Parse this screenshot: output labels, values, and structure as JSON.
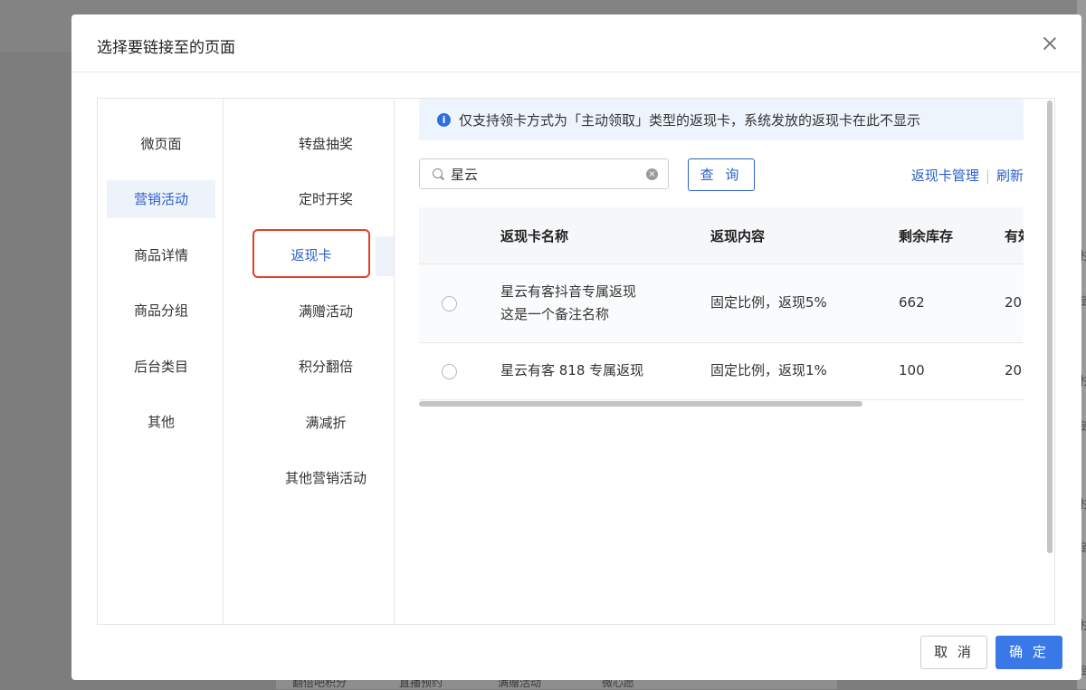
{
  "background": {
    "right_chars": [
      "杉",
      "链",
      "杉",
      "链",
      "杉",
      "链",
      "杉",
      "链"
    ],
    "bottom_labels": [
      "翻倍吧积分",
      "直播预约",
      "满赠活动",
      "微心愿"
    ]
  },
  "modal": {
    "title": "选择要链接至的页面",
    "close_icon": "close-icon"
  },
  "categories": [
    {
      "label": "微页面"
    },
    {
      "label": "营销活动"
    },
    {
      "label": "商品详情"
    },
    {
      "label": "商品分组"
    },
    {
      "label": "后台类目"
    },
    {
      "label": "其他"
    }
  ],
  "subcategories": [
    {
      "label": "转盘抽奖"
    },
    {
      "label": "定时开奖"
    },
    {
      "label": "返现卡"
    },
    {
      "label": "满赠活动"
    },
    {
      "label": "积分翻倍"
    },
    {
      "label": "满减折"
    },
    {
      "label": "其他营销活动"
    }
  ],
  "selected": {
    "category": "营销活动",
    "subcategory": "返现卡"
  },
  "info": {
    "icon": "info-icon",
    "text": "仅支持领卡方式为「主动领取」类型的返现卡，系统发放的返现卡在此不显示"
  },
  "search": {
    "value": "星云",
    "placeholder": ""
  },
  "query_label": "查 询",
  "links": {
    "manage": "返现卡管理",
    "refresh": "刷新"
  },
  "table": {
    "headers": [
      "返现卡名称",
      "返现内容",
      "剩余库存",
      "有效"
    ],
    "rows": [
      {
        "name_line1": "星云有客抖音专属返现",
        "name_line2": "这是一个备注名称",
        "content": "固定比例，返现5%",
        "stock": "662",
        "validity": "20"
      },
      {
        "name_line1": "星云有客 818 专属返现",
        "name_line2": "",
        "content": "固定比例，返现1%",
        "stock": "100",
        "validity": "20"
      }
    ]
  },
  "footer": {
    "cancel": "取 消",
    "ok": "确 定"
  },
  "colors": {
    "accent": "#2a5fc9",
    "primary_button": "#3a78e8",
    "highlight_border": "#e0402c",
    "info_bg": "#eef4fc"
  }
}
